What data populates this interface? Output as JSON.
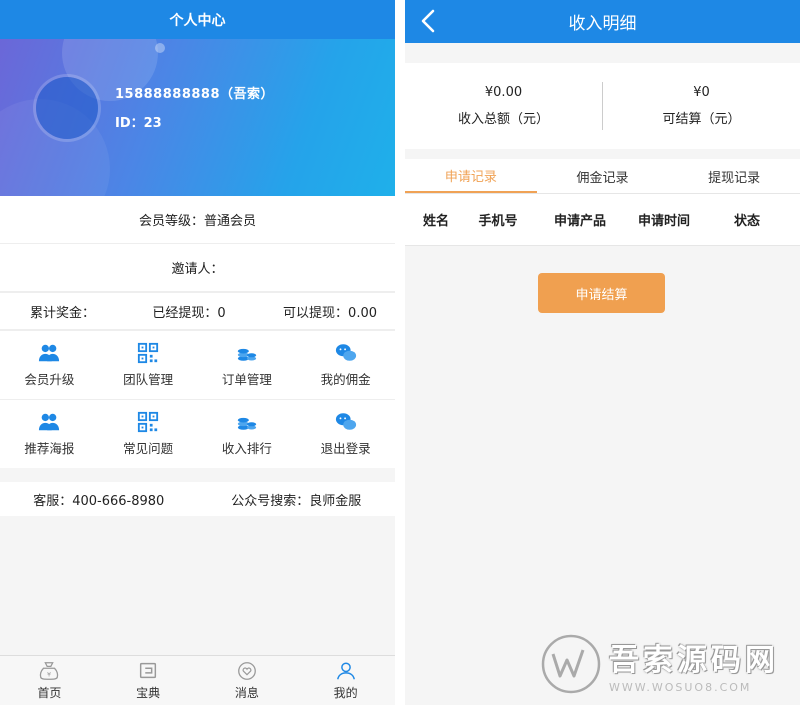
{
  "left": {
    "title": "个人中心",
    "profile": {
      "phone": "15888888888（吾索）",
      "id": "ID：23"
    },
    "level": "会员等级：普通会员",
    "inviter": "邀请人：",
    "money": {
      "total": "累计奖金：",
      "withdrawn": "已经提现：0",
      "available": "可以提现：0.00"
    },
    "grid": [
      [
        {
          "label": "会员升级",
          "icon": "members-icon"
        },
        {
          "label": "团队管理",
          "icon": "qr-code-icon"
        },
        {
          "label": "订单管理",
          "icon": "coins-icon"
        },
        {
          "label": "我的佣金",
          "icon": "chat-bubbles-icon"
        }
      ],
      [
        {
          "label": "推荐海报",
          "icon": "members-icon"
        },
        {
          "label": "常见问题",
          "icon": "qr-code-icon"
        },
        {
          "label": "收入排行",
          "icon": "coins-icon"
        },
        {
          "label": "退出登录",
          "icon": "chat-bubbles-icon"
        }
      ]
    ],
    "service": {
      "phone": "客服：400-666-8980",
      "wechat": "公众号搜索：良师金服"
    },
    "nav": [
      {
        "label": "首页",
        "icon": "money-bag-icon"
      },
      {
        "label": "宝典",
        "icon": "book-icon"
      },
      {
        "label": "消息",
        "icon": "heart-bubble-icon"
      },
      {
        "label": "我的",
        "icon": "user-icon"
      }
    ],
    "colors": {
      "header": "#1e88e5",
      "icon_blue": "#1e88e5"
    }
  },
  "right": {
    "title": "收入明细",
    "stats": [
      {
        "amount": "¥0.00",
        "label": "收入总额（元）"
      },
      {
        "amount": "¥0",
        "label": "可结算（元）"
      }
    ],
    "tabs": [
      "申请记录",
      "佣金记录",
      "提现记录"
    ],
    "active_tab": 0,
    "columns": [
      "姓名",
      "手机号",
      "申请产品",
      "申请时间",
      "状态"
    ],
    "apply_button": "申请结算",
    "watermark": {
      "main": "吾索源码网",
      "sub": "WWW.WOSUO8.COM"
    },
    "colors": {
      "accent": "#f0a050",
      "tab_active": "#f0a255"
    }
  }
}
